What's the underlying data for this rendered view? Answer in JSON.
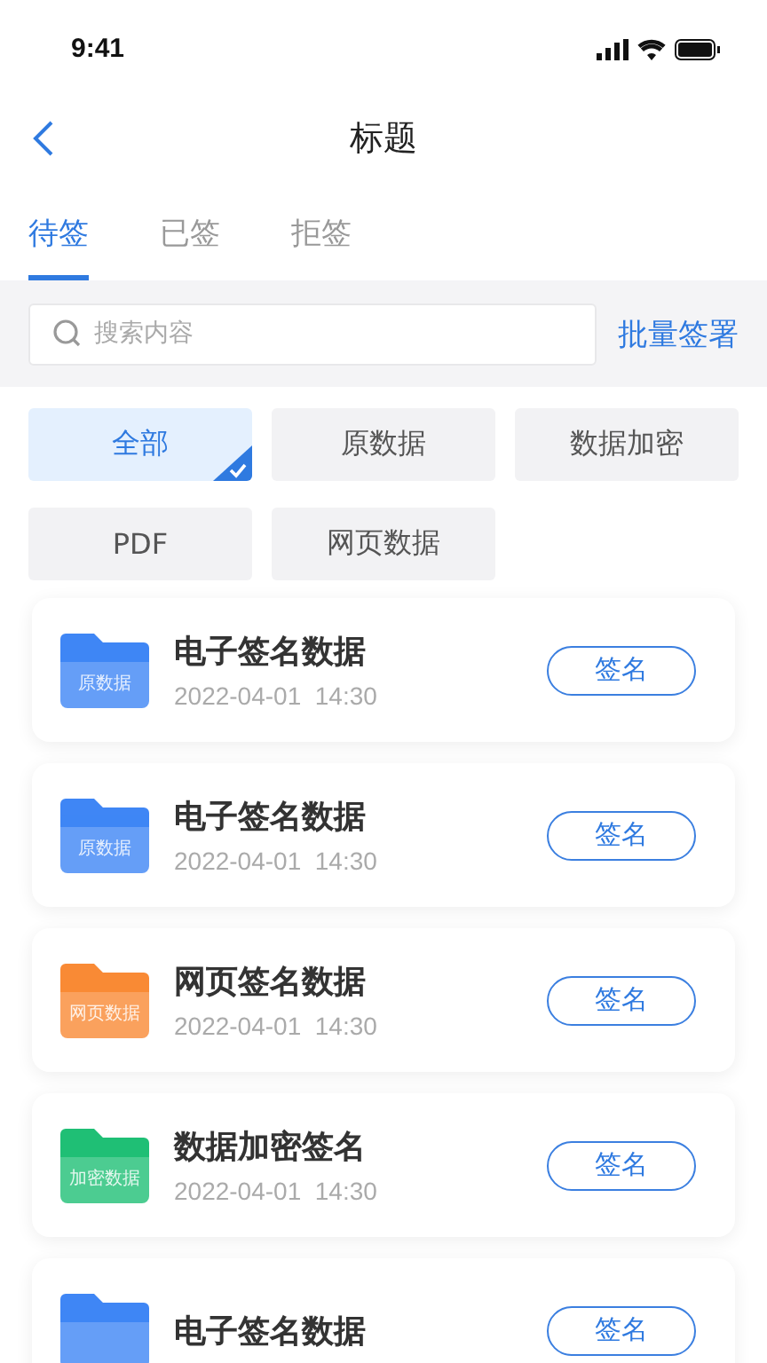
{
  "status_bar": {
    "time": "9:41"
  },
  "nav": {
    "title": "标题"
  },
  "tabs": [
    {
      "label": "待签",
      "selected": true
    },
    {
      "label": "已签",
      "selected": false
    },
    {
      "label": "拒签",
      "selected": false
    }
  ],
  "search": {
    "placeholder": "搜索内容",
    "action": "批量签署"
  },
  "filters": [
    {
      "label": "全部",
      "selected": true
    },
    {
      "label": "原数据",
      "selected": false
    },
    {
      "label": "数据加密",
      "selected": false
    },
    {
      "label": "PDF",
      "selected": false
    },
    {
      "label": "网页数据",
      "selected": false
    }
  ],
  "items": [
    {
      "icon_label": "原数据",
      "color": "#3f86f5",
      "title": "电子签名数据",
      "date": "2022-04-01  14:30",
      "button": "签名"
    },
    {
      "icon_label": "原数据",
      "color": "#3f86f5",
      "title": "电子签名数据",
      "date": "2022-04-01  14:30",
      "button": "签名"
    },
    {
      "icon_label": "网页数据",
      "color": "#f98a35",
      "title": "网页签名数据",
      "date": "2022-04-01  14:30",
      "button": "签名"
    },
    {
      "icon_label": "加密数据",
      "color": "#1fbf75",
      "title": "数据加密签名",
      "date": "2022-04-01  14:30",
      "button": "签名"
    },
    {
      "color": "#3f86f5",
      "title": "电子签名数据",
      "button": "签名"
    }
  ]
}
